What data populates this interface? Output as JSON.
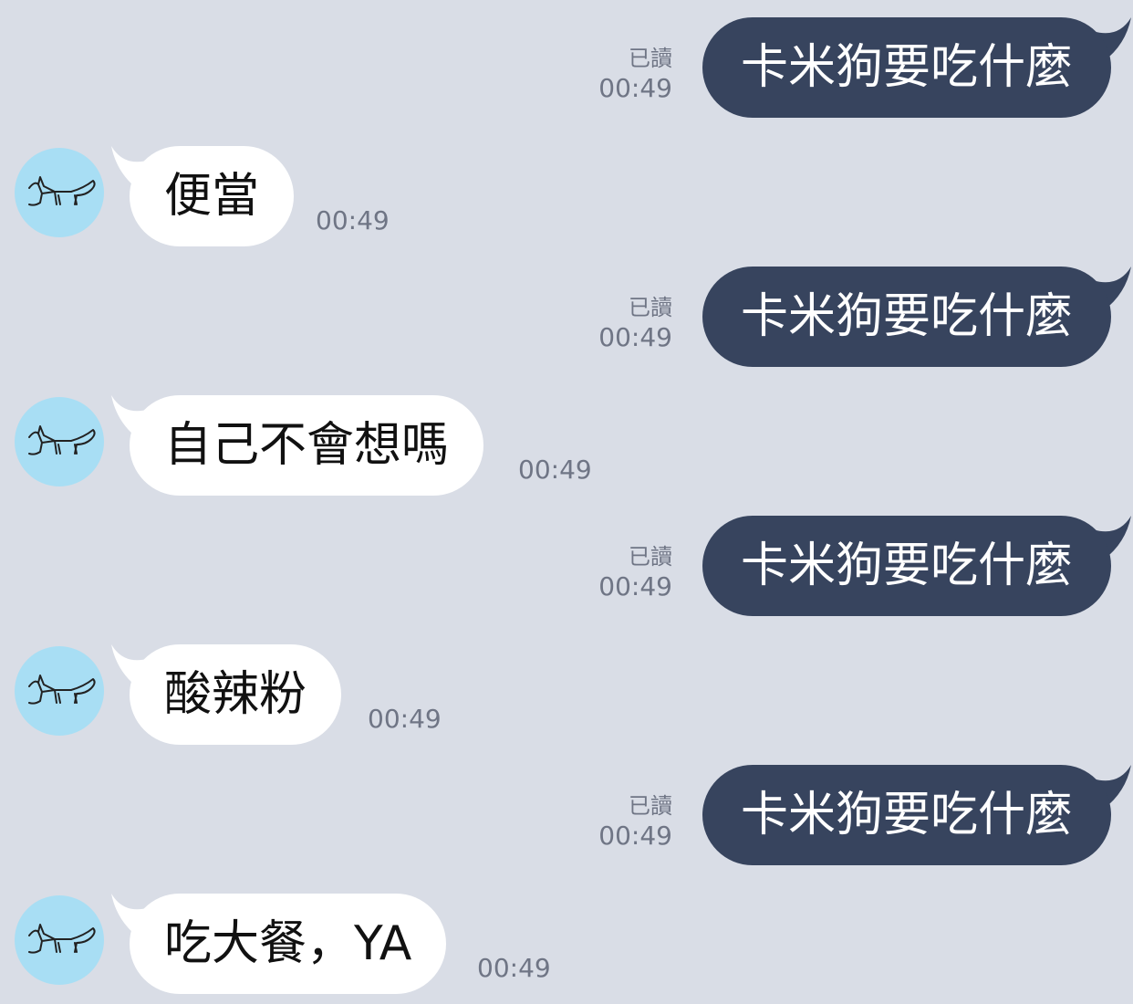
{
  "colors": {
    "background": "#d9dde6",
    "outgoing_bubble": "#37445e",
    "incoming_bubble": "#ffffff",
    "avatar_bg": "#a8def4",
    "meta_text": "#6f7585"
  },
  "contact": {
    "avatar_icon": "fox-icon"
  },
  "messages": [
    {
      "direction": "out",
      "text": "卡米狗要吃什麼",
      "read_label": "已讀",
      "time": "00:49"
    },
    {
      "direction": "in",
      "text": "便當",
      "time": "00:49"
    },
    {
      "direction": "out",
      "text": "卡米狗要吃什麼",
      "read_label": "已讀",
      "time": "00:49"
    },
    {
      "direction": "in",
      "text": "自己不會想嗎",
      "time": "00:49"
    },
    {
      "direction": "out",
      "text": "卡米狗要吃什麼",
      "read_label": "已讀",
      "time": "00:49"
    },
    {
      "direction": "in",
      "text": "酸辣粉",
      "time": "00:49"
    },
    {
      "direction": "out",
      "text": "卡米狗要吃什麼",
      "read_label": "已讀",
      "time": "00:49"
    },
    {
      "direction": "in",
      "text": "吃大餐，YA",
      "time": "00:49"
    }
  ]
}
